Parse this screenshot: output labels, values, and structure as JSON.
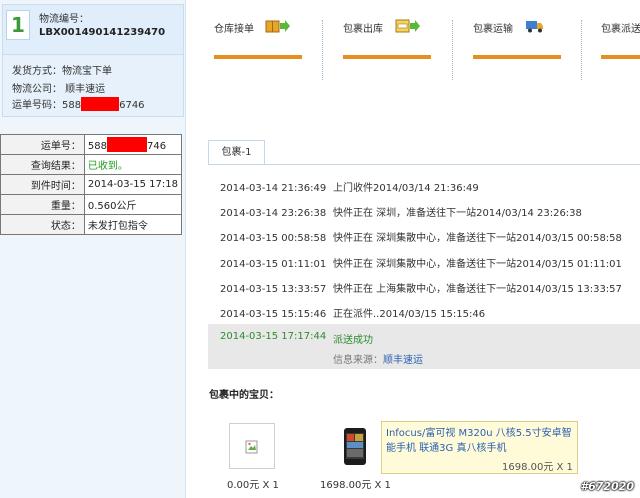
{
  "package": {
    "number": "1",
    "logistics_no_label": "物流编号：",
    "logistics_no": "LBX001490141239470",
    "shipping_method": "发货方式：物流宝下单",
    "logistics_company": "物流公司：  顺丰速运",
    "tracking_label": "运单号码：",
    "tracking_prefix": "588",
    "tracking_suffix": "6746"
  },
  "info_table": {
    "rows": [
      {
        "key": "运单号：",
        "value_prefix": "588",
        "value_suffix": "746"
      },
      {
        "key": "查询结果：",
        "value": "已收到。"
      },
      {
        "key": "到件时间：",
        "value": "2014-03-15 17:18"
      },
      {
        "key": "重量：",
        "value": "0.560公斤"
      },
      {
        "key": "状态：",
        "value": "未发打包指令"
      }
    ]
  },
  "steps": [
    {
      "label": "仓库接单",
      "icon": "warehouse-icon"
    },
    {
      "label": "包裹出库",
      "icon": "package-out-icon"
    },
    {
      "label": "包裹运输",
      "icon": "truck-icon"
    },
    {
      "label": "包裹派送",
      "icon": "delivery-icon"
    }
  ],
  "tab": {
    "label": "包裹-1"
  },
  "log": [
    {
      "time": "2014-03-14 21:36:49",
      "text": "上门收件2014/03/14 21:36:49"
    },
    {
      "time": "2014-03-14 23:26:38",
      "text": "快件正在 深圳，准备送往下一站2014/03/14 23:26:38"
    },
    {
      "time": "2014-03-15 00:58:58",
      "text": "快件正在 深圳集散中心，准备送往下一站2014/03/15 00:58:58"
    },
    {
      "time": "2014-03-15 01:11:01",
      "text": "快件正在 深圳集散中心，准备送往下一站2014/03/15 01:11:01"
    },
    {
      "time": "2014-03-15 13:33:57",
      "text": "快件正在 上海集散中心，准备送往下一站2014/03/15 13:33:57"
    },
    {
      "time": "2014-03-15 15:15:46",
      "text": "正在派件..2014/03/15 15:15:46"
    }
  ],
  "last": {
    "time": "2014-03-15 17:17:44",
    "text": "派送成功",
    "source_label": "信息来源：",
    "source_value": "顺丰速运"
  },
  "items_title": "包裹中的宝贝：",
  "items": [
    {
      "price": "0.00元 X 1",
      "image": "broken-image-icon"
    },
    {
      "price": "1698.00元 X 1",
      "image": "phone-icon"
    }
  ],
  "tooltip": {
    "name": "Infocus/富可视 M320u 八核5.5寸安卓智能手机 联通3G 真八核手机",
    "price": "1698.00元 X 1"
  },
  "watermark": "#672020",
  "colors": {
    "accent_bar": "#e68f1e",
    "success": "#2e8a2e",
    "link": "#2b61b3",
    "redacted": "#ff0000"
  }
}
